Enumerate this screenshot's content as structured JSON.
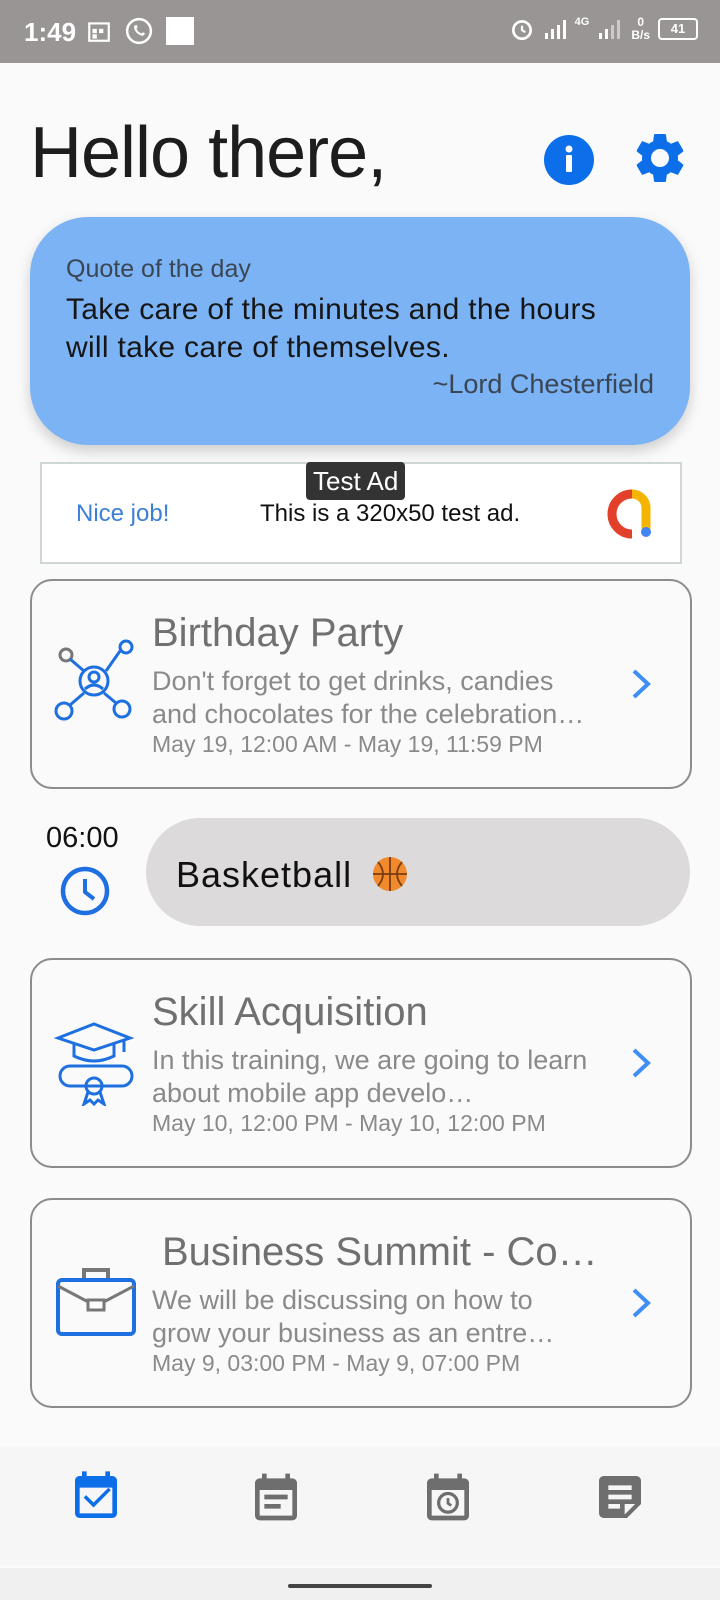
{
  "status_bar": {
    "time": "1:49",
    "network": "4G",
    "speed_value": "0",
    "speed_unit": "B/s",
    "battery": "41"
  },
  "header": {
    "greeting": "Hello there,"
  },
  "quote": {
    "title": "Quote of the day",
    "text": "Take care of the minutes and the hours will take care of themselves.",
    "author": "~Lord Chesterfield"
  },
  "ad": {
    "tag": "Test Ad",
    "nice": "Nice job!",
    "text": "This is a 320x50 test ad."
  },
  "events": [
    {
      "title": "Birthday Party",
      "desc": "Don't forget to get drinks, candies and chocolates for the celebration…",
      "date": "May 19, 12:00 AM - May 19, 11:59 PM",
      "icon": "network-people-icon"
    },
    {
      "title": "Skill Acquisition",
      "desc": "In this training, we are going to learn about mobile app develo…",
      "date": "May 10, 12:00 PM - May 10, 12:00 PM",
      "icon": "graduation-icon"
    },
    {
      "title": "Business Summit - Co…",
      "desc": "We will be discussing on how to grow your business as an entre…",
      "date": "May 9, 03:00 PM - May 9, 07:00 PM",
      "icon": "briefcase-icon"
    }
  ],
  "routine": {
    "time": "06:00",
    "title": "Basketball"
  },
  "colors": {
    "accent": "#0d6eea",
    "quote_bg": "#7cb3f5",
    "pill_bg": "#dcdadb",
    "inactive_nav": "#6e6e6e"
  },
  "nav": [
    "event-check-icon",
    "notes-icon",
    "schedule-icon",
    "document-icon"
  ]
}
